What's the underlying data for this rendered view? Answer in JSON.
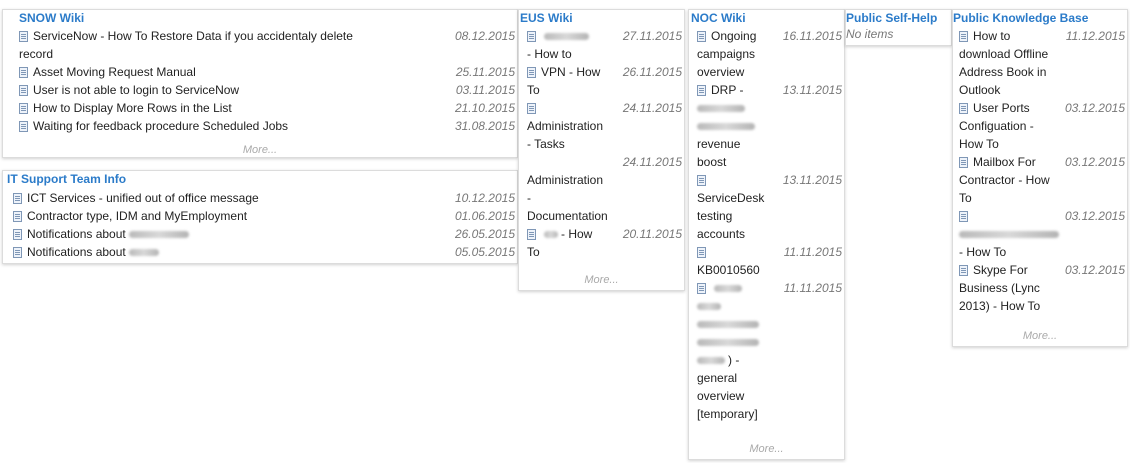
{
  "colors": {
    "title": "#2b7bc9",
    "date": "#777777",
    "more": "#aaaaaa"
  },
  "icons": {
    "item": "document-icon"
  },
  "snow": {
    "title": "SNOW Wiki",
    "items": [
      {
        "text": "ServiceNow - How To Restore Data if you accidentaly delete",
        "text2": "record",
        "date": "08.12.2015"
      },
      {
        "text": "Asset Moving Request Manual",
        "date": "25.11.2015"
      },
      {
        "text": "User is not able to login to ServiceNow",
        "date": "03.11.2015"
      },
      {
        "text": "How to Display More Rows in the List",
        "date": "21.10.2015"
      },
      {
        "text": "Waiting for feedback procedure Scheduled Jobs",
        "date": "31.08.2015"
      }
    ],
    "more": "More..."
  },
  "itsupport": {
    "title": "IT Support Team Info",
    "items": [
      {
        "text": "ICT Services - unified out of office message",
        "date": "10.12.2015"
      },
      {
        "text": "Contractor type, IDM and MyEmployment",
        "date": "01.06.2015"
      },
      {
        "text": "Notifications about",
        "date": "26.05.2015"
      },
      {
        "text": "Notifications about",
        "date": "05.05.2015"
      }
    ]
  },
  "eus": {
    "title": "EUS Wiki",
    "items": [
      {
        "l1": "",
        "l2": "- How to",
        "date": "27.11.2015"
      },
      {
        "l1": "VPN - How",
        "l2": "To",
        "date": "26.11.2015"
      },
      {
        "l1": "",
        "l2": "Administration",
        "l3": "- Tasks",
        "date": "24.11.2015"
      },
      {
        "l1": "",
        "l2": "Administration",
        "l3": "-",
        "l4": "Documentation",
        "date": "24.11.2015"
      },
      {
        "l1": "- How",
        "l2": "To",
        "date": "20.11.2015"
      }
    ],
    "more": "More..."
  },
  "noc": {
    "title": "NOC Wiki",
    "items": [
      {
        "l1": "Ongoing",
        "l2": "campaigns",
        "l3": "overview",
        "date": "16.11.2015"
      },
      {
        "l1": "DRP -",
        "l4": "revenue",
        "l5": "boost",
        "date": "13.11.2015"
      },
      {
        "l2": "ServiceDesk",
        "l3": "testing",
        "l4": "accounts",
        "date": "13.11.2015"
      },
      {
        "l2": "KB0010560",
        "date": "11.11.2015"
      },
      {
        "l5": ") -",
        "l6": "general",
        "l7": "overview",
        "l8": "[temporary]",
        "date": "11.11.2015"
      }
    ],
    "more": "More..."
  },
  "selfhelp": {
    "title": "Public Self-Help",
    "empty": "No items"
  },
  "pkb": {
    "title": "Public Knowledge Base",
    "items": [
      {
        "l1": "How to",
        "l2": "download Offline",
        "l3": "Address Book in",
        "l4": "Outlook",
        "date": "11.12.2015"
      },
      {
        "l1": "User Ports",
        "l2": "Configuation -",
        "l3": "How To",
        "date": "03.12.2015"
      },
      {
        "l1": "Mailbox For",
        "l2": "Contractor - How",
        "l3": "To",
        "date": "03.12.2015"
      },
      {
        "l3": "- How To",
        "date": "03.12.2015"
      },
      {
        "l1": "Skype For",
        "l2": "Business (Lync",
        "l3": "2013) - How To",
        "date": "03.12.2015"
      }
    ],
    "more": "More..."
  }
}
